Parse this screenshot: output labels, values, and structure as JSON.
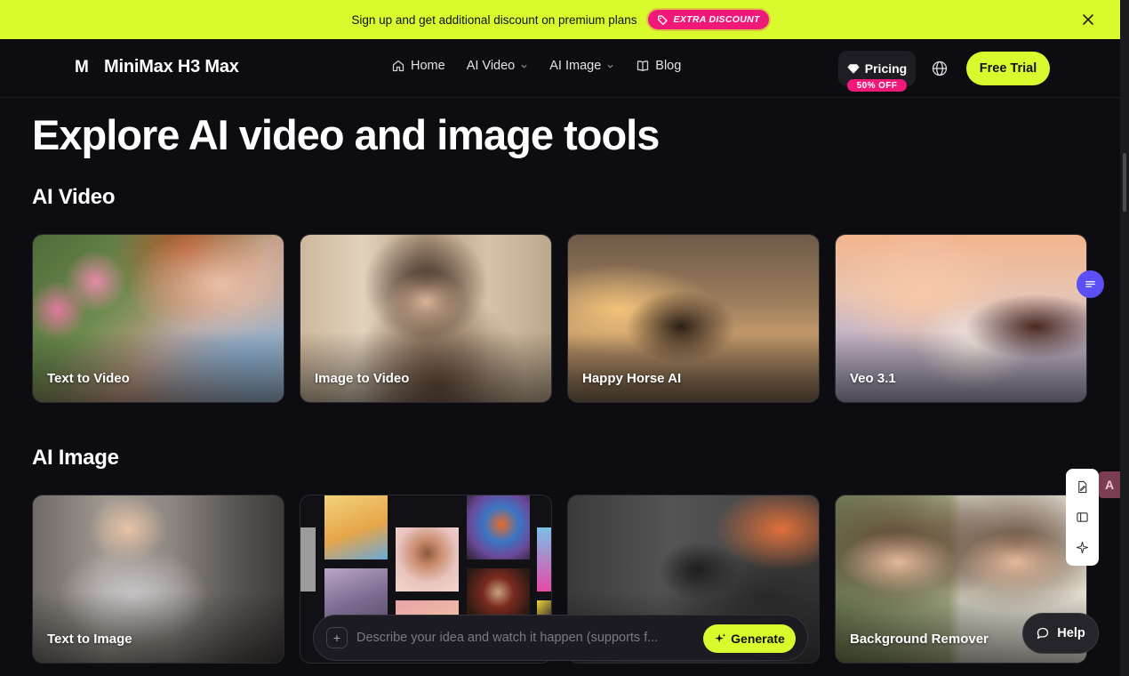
{
  "banner": {
    "text": "Sign up and get additional discount on premium plans",
    "discount_label": "EXTRA DISCOUNT",
    "close_icon": "close-icon"
  },
  "nav": {
    "logo_mark": "M",
    "brand": "MiniMax H3 Max",
    "links": [
      {
        "label": "Home",
        "icon": "home-icon"
      },
      {
        "label": "AI Video",
        "icon": "chevron-down-icon"
      },
      {
        "label": "AI Image",
        "icon": "chevron-down-icon"
      },
      {
        "label": "Blog",
        "icon": "book-icon"
      }
    ],
    "pricing_label": "Pricing",
    "pricing_badge": "50% OFF",
    "free_trial_label": "Free Trial"
  },
  "page": {
    "title": "Explore AI video and image tools"
  },
  "sections": {
    "video": {
      "title": "AI Video",
      "cards": [
        "Text to Video",
        "Image to Video",
        "Happy Horse AI",
        "Veo 3.1"
      ]
    },
    "image": {
      "title": "AI Image",
      "cards": [
        "Text to Image",
        "",
        "",
        "Background Remover"
      ]
    }
  },
  "prompt": {
    "placeholder": "Describe your idea and watch it happen (supports f...",
    "generate_label": "Generate"
  },
  "help_label": "Help",
  "avatar_letter": "A",
  "colors": {
    "accent": "#d9fb2e",
    "pink": "#f0197a",
    "background": "#0d0c11",
    "chat_fab": "#5b4ff5"
  }
}
